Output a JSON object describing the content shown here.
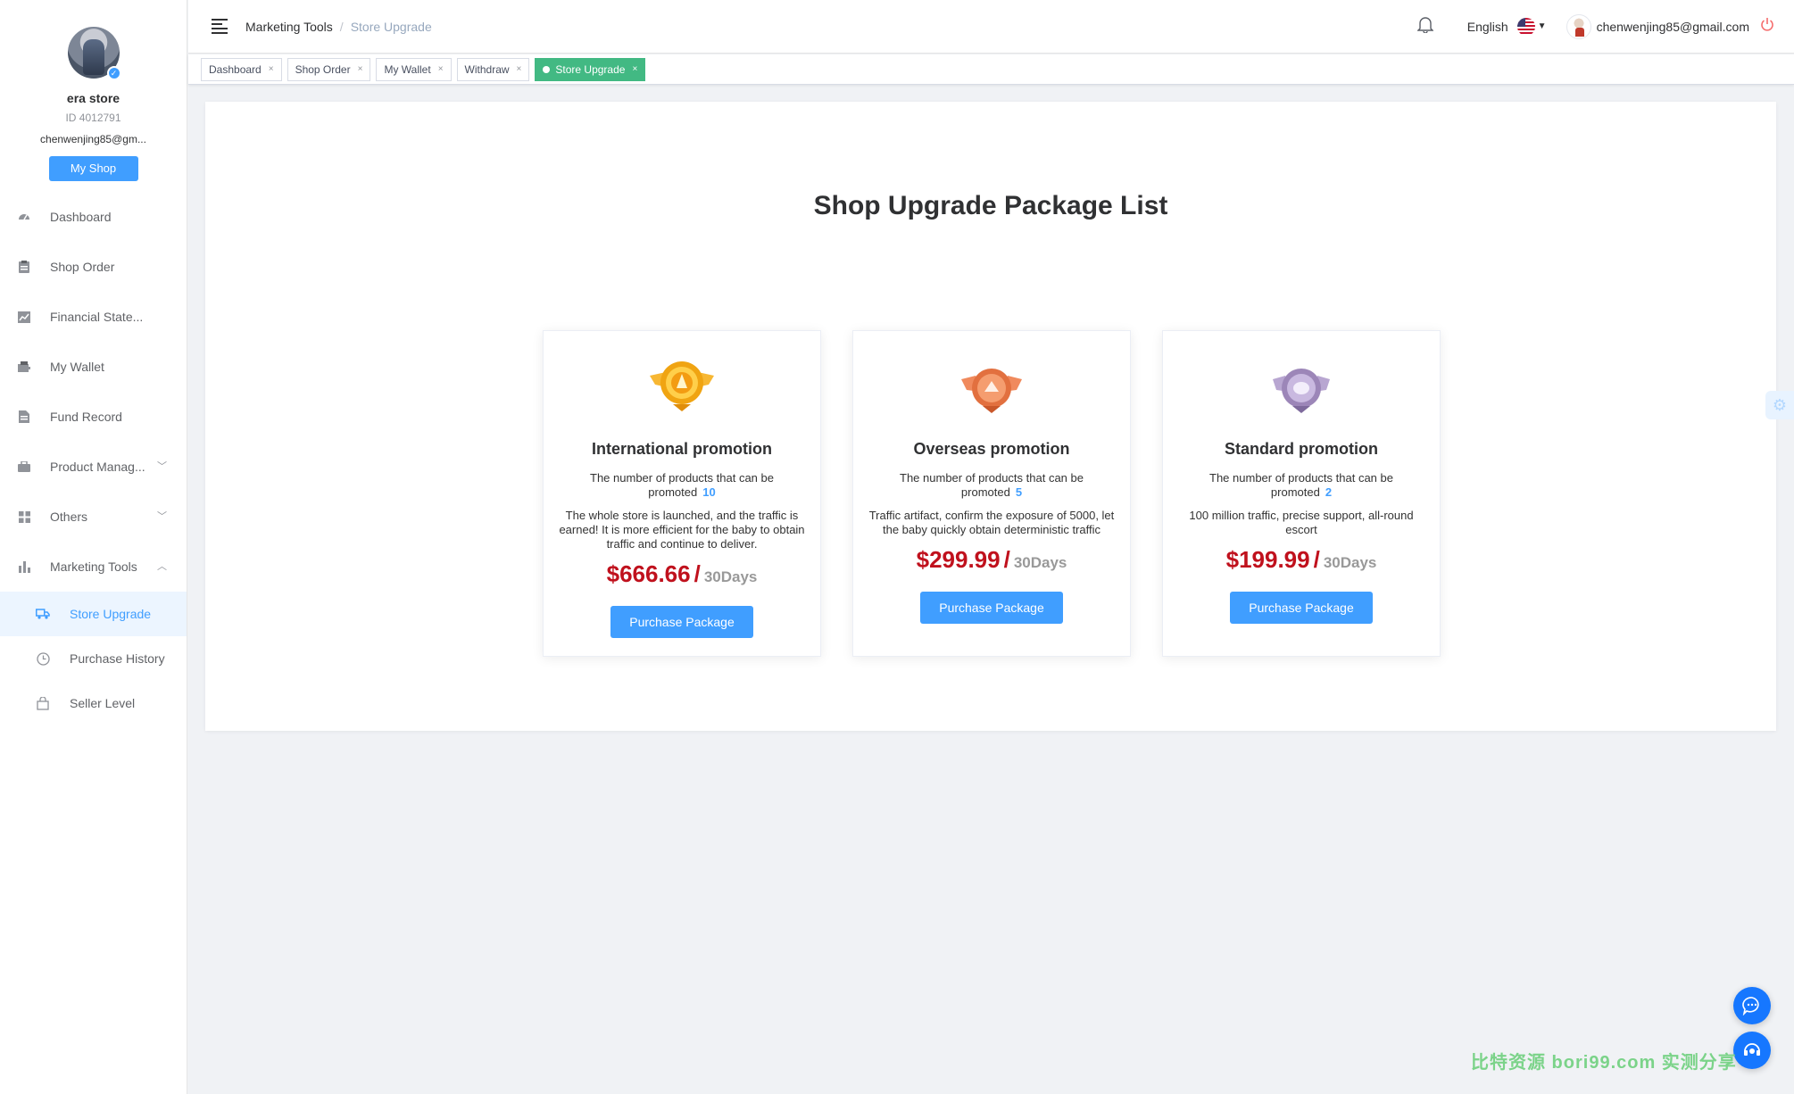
{
  "profile": {
    "store_name": "era store",
    "store_id": "ID 4012791",
    "email": "chenwenjing85@gm...",
    "my_shop_label": "My Shop"
  },
  "sidebar": {
    "items": [
      {
        "label": "Dashboard",
        "icon": "dashboard-icon"
      },
      {
        "label": "Shop Order",
        "icon": "clipboard-icon"
      },
      {
        "label": "Financial State...",
        "icon": "chart-icon"
      },
      {
        "label": "My Wallet",
        "icon": "wallet-icon"
      },
      {
        "label": "Fund Record",
        "icon": "document-icon"
      },
      {
        "label": "Product Manag...",
        "icon": "briefcase-icon"
      },
      {
        "label": "Others",
        "icon": "grid-icon"
      },
      {
        "label": "Marketing Tools",
        "icon": "bar-chart-icon"
      }
    ],
    "submenu": [
      {
        "label": "Store Upgrade",
        "icon": "truck-icon"
      },
      {
        "label": "Purchase History",
        "icon": "clock-icon"
      },
      {
        "label": "Seller Level",
        "icon": "shopping-bag-icon"
      }
    ]
  },
  "header": {
    "breadcrumb_parent": "Marketing Tools",
    "breadcrumb_separator": "/",
    "breadcrumb_current": "Store Upgrade",
    "language": "English",
    "user_email": "chenwenjing85@gmail.com"
  },
  "tags": [
    "Dashboard",
    "Shop Order",
    "My Wallet",
    "Withdraw",
    "Store Upgrade"
  ],
  "tag_close": "×",
  "main": {
    "title": "Shop Upgrade Package List",
    "count_text": "The number of products that can be promoted",
    "packages": [
      {
        "name": "International promotion",
        "count": "10",
        "description": "The whole store is launched, and the traffic is earned! It is more efficient for the baby to obtain traffic and continue to deliver.",
        "price": "$666.66",
        "period": "30Days",
        "button": "Purchase Package",
        "badge_color": "#f0a412"
      },
      {
        "name": "Overseas promotion",
        "count": "5",
        "description": "Traffic artifact, confirm the exposure of 5000, let the baby quickly obtain deterministic traffic",
        "price": "$299.99",
        "period": "30Days",
        "button": "Purchase Package",
        "badge_color": "#e2703f"
      },
      {
        "name": "Standard promotion",
        "count": "2",
        "description": "100 million traffic, precise support, all-round escort",
        "price": "$199.99",
        "period": "30Days",
        "button": "Purchase Package",
        "badge_color": "#9c86b8"
      }
    ]
  },
  "price_slash": "/",
  "watermark": "比特资源 bori99.com 实测分享",
  "colors": {
    "primary": "#409eff",
    "price": "#c0111d",
    "active_tag": "#42b983"
  }
}
